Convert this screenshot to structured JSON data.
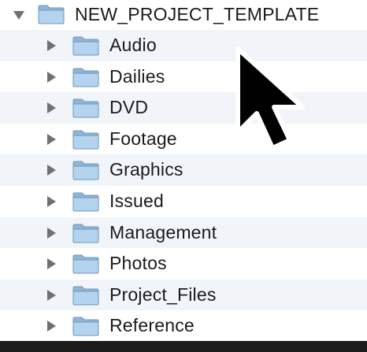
{
  "tree": {
    "root": {
      "label": "NEW_PROJECT_TEMPLATE",
      "expanded": true
    },
    "children": [
      {
        "label": "Audio"
      },
      {
        "label": "Dailies"
      },
      {
        "label": "DVD"
      },
      {
        "label": "Footage"
      },
      {
        "label": "Graphics"
      },
      {
        "label": "Issued"
      },
      {
        "label": "Management"
      },
      {
        "label": "Photos"
      },
      {
        "label": "Project_Files"
      },
      {
        "label": "Reference"
      }
    ]
  },
  "colors": {
    "row_alt": "#f1f5fa",
    "folder_body": "#a9cbe8",
    "folder_edge": "#6f96b8",
    "disclosure": "#707070",
    "cursor": "#000000"
  },
  "icons": {
    "disclosure_collapsed": "triangle-right-icon",
    "disclosure_expanded": "triangle-down-icon",
    "folder": "folder-icon",
    "pointer": "mouse-pointer-icon"
  }
}
